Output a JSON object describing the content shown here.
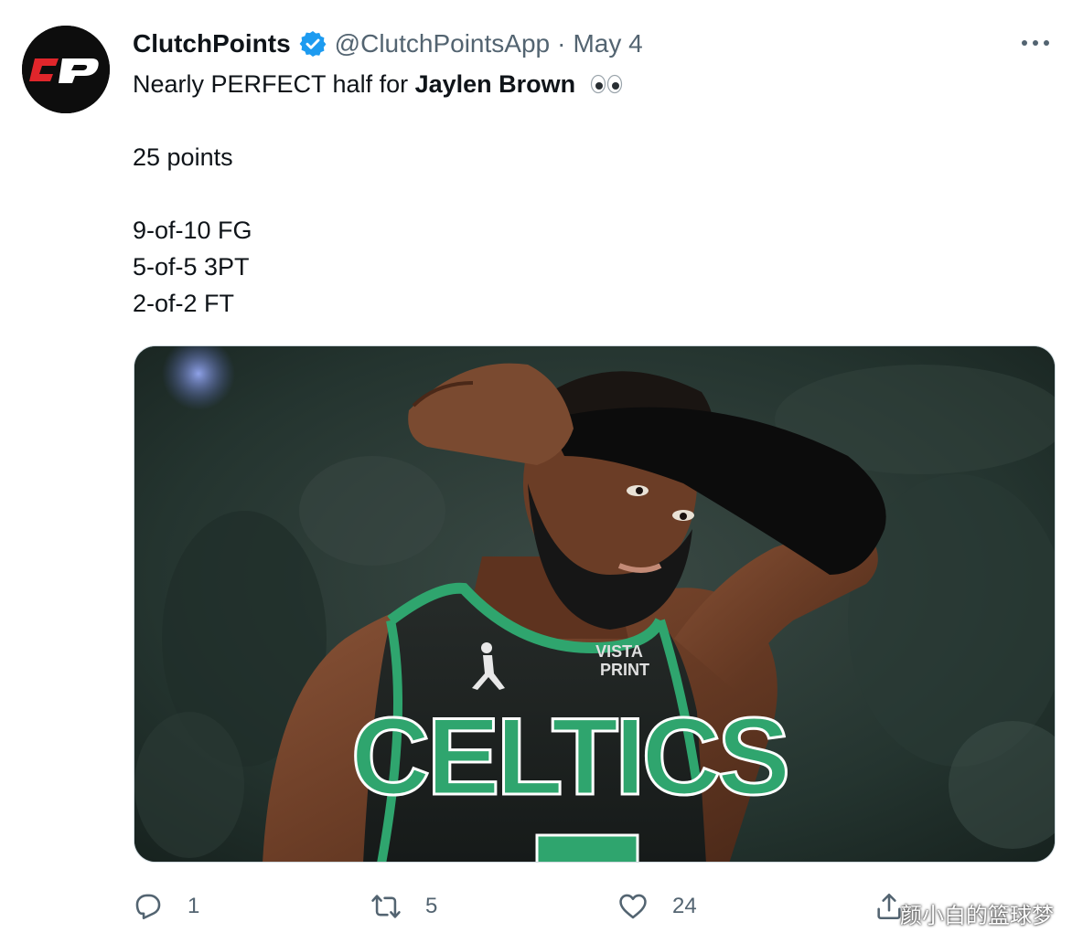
{
  "author": {
    "display_name": "ClutchPoints",
    "handle": "@ClutchPointsApp",
    "separator": "·",
    "date": "May 4",
    "avatar_letters": "CP",
    "verified_icon": "verified-badge-icon"
  },
  "tweet": {
    "line1_prefix": "Nearly PERFECT half for ",
    "line1_name": "Jaylen Brown",
    "line1_emoji": "eyes-emoji-icon",
    "stat_points": "25 points",
    "stat_fg": "9-of-10 FG",
    "stat_3pt": "5-of-5 3PT",
    "stat_ft": "2-of-2 FT"
  },
  "media": {
    "jersey_text": "CELTICS",
    "sponsor_line1": "VISTA",
    "sponsor_line2": "PRINT"
  },
  "actions": {
    "reply_count": "1",
    "retweet_count": "5",
    "like_count": "24"
  },
  "watermark": "颜小白的篮球梦",
  "colors": {
    "verified": "#1d9bf0",
    "text": "#0f1419",
    "secondary": "#536471",
    "celtics_green": "#2fa56e",
    "avatar_red": "#e0262b"
  }
}
